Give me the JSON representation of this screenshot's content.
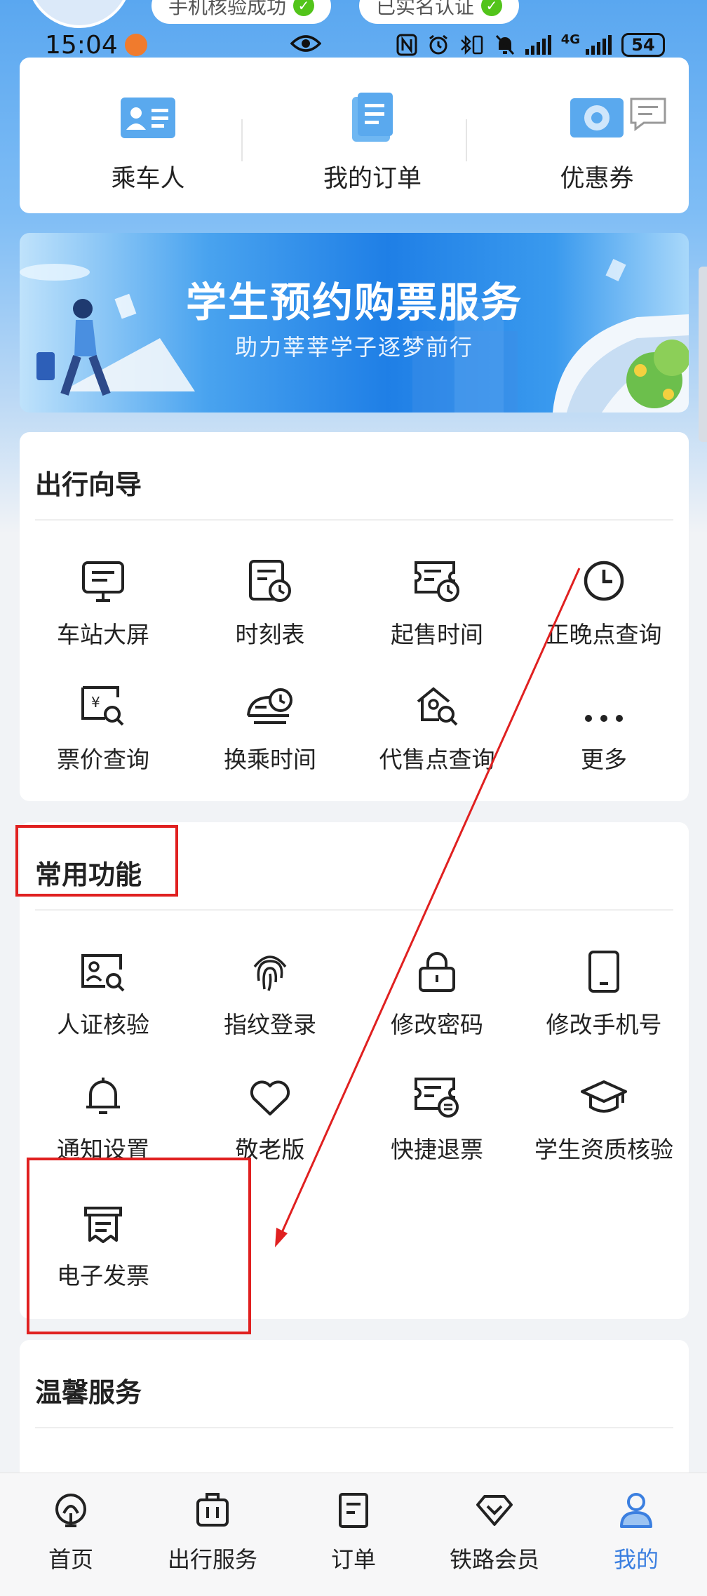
{
  "header": {
    "badges": [
      {
        "label": "手机核验成功"
      },
      {
        "label": "已实名认证"
      }
    ]
  },
  "status_bar": {
    "time": "15:04",
    "network": "4G",
    "battery": "54"
  },
  "quick_links": [
    {
      "label": "乘车人",
      "icon": "passenger-card-icon"
    },
    {
      "label": "我的订单",
      "icon": "order-document-icon"
    },
    {
      "label": "优惠券",
      "icon": "coupon-gear-icon"
    }
  ],
  "banner": {
    "title": "学生预约购票服务",
    "subtitle": "助力莘莘学子逐梦前行"
  },
  "travel_guide": {
    "title": "出行向导",
    "items": [
      {
        "label": "车站大屏",
        "icon": "station-screen-icon"
      },
      {
        "label": "时刻表",
        "icon": "timetable-icon"
      },
      {
        "label": "起售时间",
        "icon": "sale-time-icon"
      },
      {
        "label": "正晚点查询",
        "icon": "clock-icon"
      },
      {
        "label": "票价查询",
        "icon": "fare-search-icon"
      },
      {
        "label": "换乘时间",
        "icon": "transfer-time-icon"
      },
      {
        "label": "代售点查询",
        "icon": "agency-search-icon"
      },
      {
        "label": "更多",
        "icon": "more-dots-icon"
      }
    ]
  },
  "common_functions": {
    "title": "常用功能",
    "items": [
      {
        "label": "人证核验",
        "icon": "id-verify-icon"
      },
      {
        "label": "指纹登录",
        "icon": "fingerprint-icon"
      },
      {
        "label": "修改密码",
        "icon": "lock-icon"
      },
      {
        "label": "修改手机号",
        "icon": "phone-icon"
      },
      {
        "label": "通知设置",
        "icon": "bell-icon"
      },
      {
        "label": "敬老版",
        "icon": "heart-icon"
      },
      {
        "label": "快捷退票",
        "icon": "refund-ticket-icon"
      },
      {
        "label": "学生资质核验",
        "icon": "graduation-cap-icon"
      },
      {
        "label": "电子发票",
        "icon": "invoice-icon"
      }
    ]
  },
  "warm_service": {
    "title": "温馨服务"
  },
  "tabbar": {
    "items": [
      {
        "label": "首页",
        "icon": "home-rail-icon"
      },
      {
        "label": "出行服务",
        "icon": "luggage-icon"
      },
      {
        "label": "订单",
        "icon": "order-icon"
      },
      {
        "label": "铁路会员",
        "icon": "diamond-icon"
      },
      {
        "label": "我的",
        "icon": "user-icon",
        "active": true
      }
    ]
  },
  "colors": {
    "accent": "#3b7fe0",
    "annotation": "#e02020",
    "header_gradient_top": "#5aa7f0"
  }
}
